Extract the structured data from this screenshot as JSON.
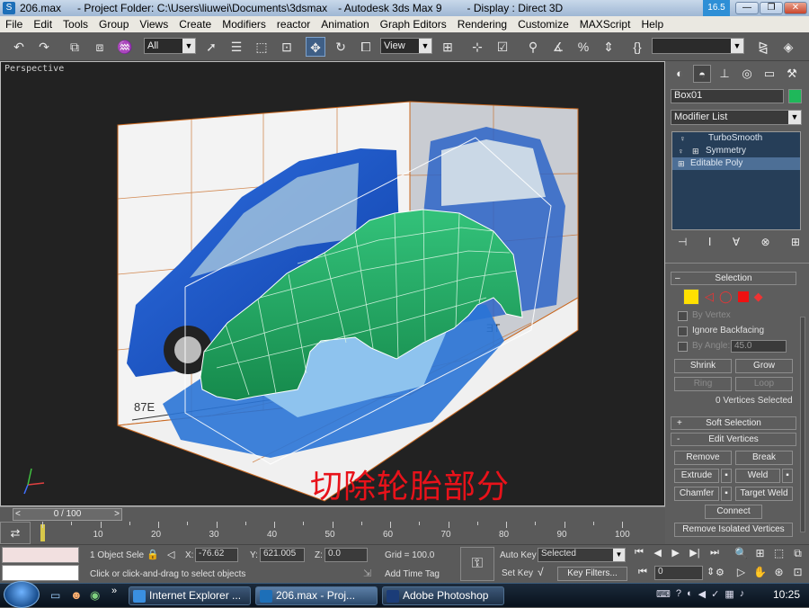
{
  "window": {
    "title_file": "206.max",
    "title_project": "- Project Folder: C:\\Users\\liuwei\\Documents\\3dsmax",
    "title_app": "- Autodesk 3ds Max 9",
    "title_display": "- Display : Direct 3D",
    "cpu_meter": "16.5 %"
  },
  "menu": [
    "File",
    "Edit",
    "Tools",
    "Group",
    "Views",
    "Create",
    "Modifiers",
    "reactor",
    "Animation",
    "Graph Editors",
    "Rendering",
    "Customize",
    "MAXScript",
    "Help"
  ],
  "toolbar": {
    "selection_filter": "All",
    "ref_coord": "View",
    "named_sel": ""
  },
  "viewport": {
    "label": "Perspective",
    "annotation": "切除轮胎部分",
    "plate_text_side": "87E",
    "plate_text_back": "ƎT"
  },
  "command_panel": {
    "object_name": "Box01",
    "object_color": "#1fb85a",
    "modifier_list": "Modifier List",
    "stack": [
      {
        "label": "TurboSmooth",
        "selected": false
      },
      {
        "label": "Symmetry",
        "selected": false
      },
      {
        "label": "Editable Poly",
        "selected": true
      }
    ],
    "selection": {
      "title": "Selection",
      "by_vertex": "By Vertex",
      "ignore_backfacing": "Ignore Backfacing",
      "by_angle": "By Angle:",
      "angle_value": "45.0",
      "shrink": "Shrink",
      "grow": "Grow",
      "ring": "Ring",
      "loop": "Loop",
      "status": "0 Vertices Selected"
    },
    "soft_selection": {
      "title": "Soft Selection",
      "collapse_mark": "+"
    },
    "edit_vertices": {
      "title": "Edit Vertices",
      "collapse_mark": "-",
      "remove": "Remove",
      "break": "Break",
      "extrude": "Extrude",
      "weld": "Weld",
      "chamfer": "Chamfer",
      "target_weld": "Target Weld",
      "connect": "Connect",
      "remove_isolated": "Remove Isolated Vertices"
    }
  },
  "time_slider": {
    "label": "0 / 100",
    "ticks": [
      "10",
      "20",
      "30",
      "40",
      "50",
      "60",
      "70",
      "80",
      "90",
      "100"
    ]
  },
  "status_bar": {
    "selection_count": "1 Object Sele",
    "x_label": "X:",
    "x_value": "-76.62",
    "y_label": "Y:",
    "y_value": "621.005",
    "z_label": "Z:",
    "z_value": "0.0",
    "grid": "Grid = 100.0",
    "prompt": "Click or click-and-drag to select objects",
    "add_time_tag": "Add Time Tag",
    "auto_key": "Auto Key",
    "set_key": "Set Key",
    "key_mode": "Selected",
    "key_filters": "Key Filters...",
    "frame": "0"
  },
  "taskbar": {
    "tasks": [
      {
        "label": "Internet Explorer ..."
      },
      {
        "label": "206.max      - Proj..."
      },
      {
        "label": "Adobe Photoshop"
      }
    ],
    "clock": "10:25"
  }
}
